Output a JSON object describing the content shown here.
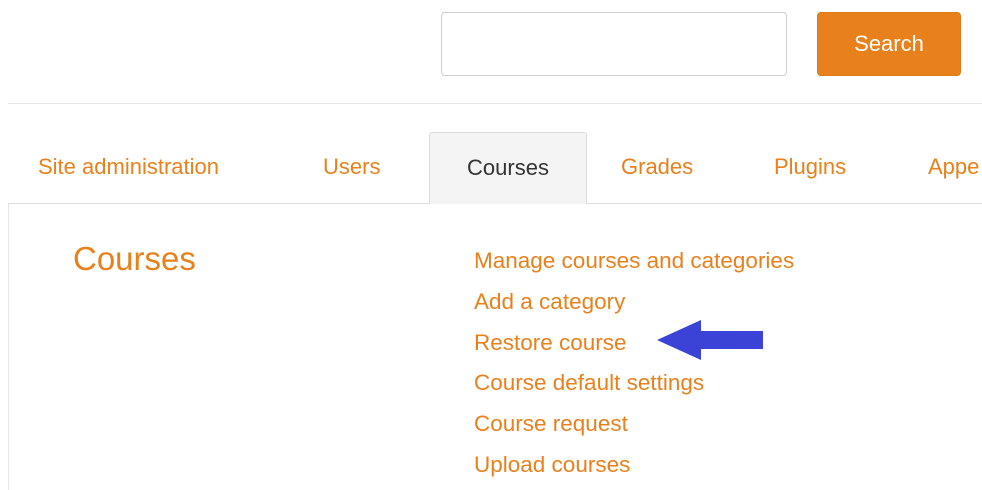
{
  "search": {
    "value": "",
    "placeholder": "",
    "button_label": "Search"
  },
  "tabs": [
    {
      "label": "Site administration",
      "active": false
    },
    {
      "label": "Users",
      "active": false
    },
    {
      "label": "Courses",
      "active": true
    },
    {
      "label": "Grades",
      "active": false
    },
    {
      "label": "Plugins",
      "active": false
    },
    {
      "label": "Appe",
      "active": false
    }
  ],
  "section": {
    "title": "Courses",
    "links": [
      "Manage courses and categories",
      "Add a category",
      "Restore course",
      "Course default settings",
      "Course request",
      "Upload courses"
    ]
  },
  "annotation": {
    "icon": "arrow-left-icon",
    "color": "#3a43d6"
  },
  "colors": {
    "accent": "#e8801b",
    "active_tab_bg": "#f4f4f4",
    "text_dark": "#333333"
  }
}
